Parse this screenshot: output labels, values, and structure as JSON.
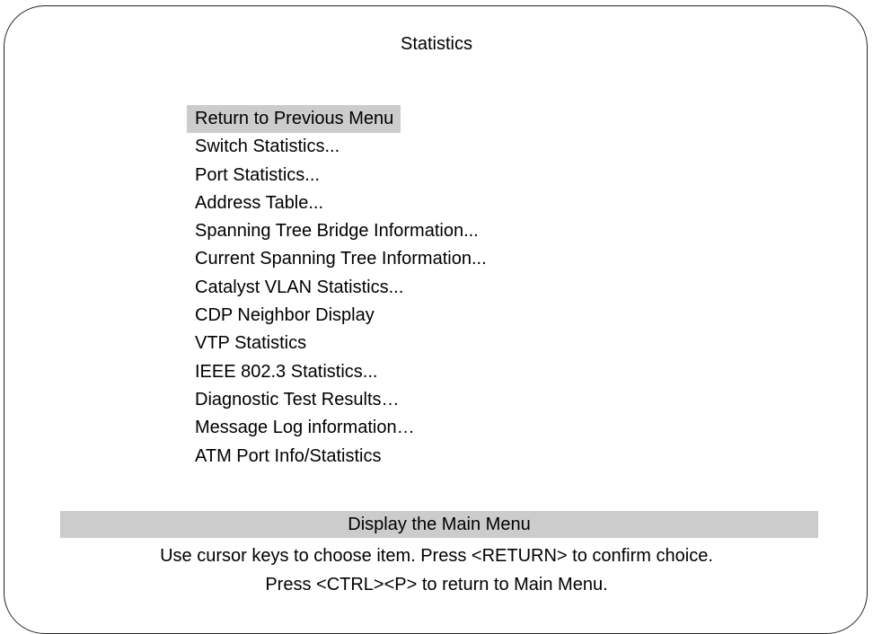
{
  "screen": {
    "title": "Statistics"
  },
  "menu": {
    "items": [
      {
        "label": "Return to Previous Menu",
        "selected": true
      },
      {
        "label": "Switch Statistics...",
        "selected": false
      },
      {
        "label": "Port Statistics...",
        "selected": false
      },
      {
        "label": "Address Table...",
        "selected": false
      },
      {
        "label": "Spanning Tree Bridge Information...",
        "selected": false
      },
      {
        "label": "Current Spanning Tree Information...",
        "selected": false
      },
      {
        "label": "Catalyst VLAN Statistics...",
        "selected": false
      },
      {
        "label": "CDP Neighbor Display",
        "selected": false
      },
      {
        "label": "VTP Statistics",
        "selected": false
      },
      {
        "label": "IEEE 802.3 Statistics...",
        "selected": false
      },
      {
        "label": "Diagnostic Test Results…",
        "selected": false
      },
      {
        "label": "Message Log information…",
        "selected": false
      },
      {
        "label": "ATM Port Info/Statistics",
        "selected": false
      }
    ]
  },
  "help": {
    "item_description": "Display the Main Menu",
    "line1": "Use cursor keys to choose item. Press <RETURN> to confirm choice.",
    "line2": "Press <CTRL><P> to return to Main Menu."
  },
  "colors": {
    "highlight": "#cccccc",
    "text": "#000000",
    "background": "#ffffff"
  }
}
